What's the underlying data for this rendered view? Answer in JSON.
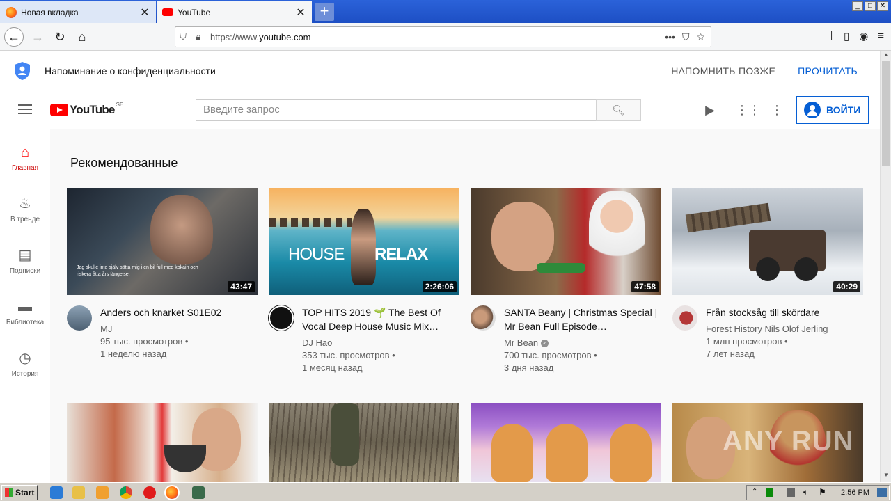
{
  "browser": {
    "tabs": [
      {
        "label": "Новая вкладка",
        "active": false
      },
      {
        "label": "YouTube",
        "active": true
      }
    ],
    "url_prefix": "https://www.",
    "url_host": "youtube.com"
  },
  "privacy": {
    "text": "Напоминание о конфиденциальности",
    "later": "НАПОМНИТЬ ПОЗЖЕ",
    "read": "ПРОЧИТАТЬ"
  },
  "header": {
    "logo": "YouTube",
    "country": "SE",
    "search_placeholder": "Введите запрос",
    "signin": "ВОЙТИ"
  },
  "sidebar": {
    "items": [
      {
        "label": "Главная",
        "icon": "home-icon",
        "glyph": "⌂"
      },
      {
        "label": "В тренде",
        "icon": "trending-icon",
        "glyph": "♨"
      },
      {
        "label": "Подписки",
        "icon": "subscriptions-icon",
        "glyph": "▤"
      },
      {
        "label": "Библиотека",
        "icon": "library-icon",
        "glyph": "▬"
      },
      {
        "label": "История",
        "icon": "history-icon",
        "glyph": "◷"
      }
    ]
  },
  "main": {
    "heading": "Рекомендованные",
    "videos": [
      {
        "title": "Anders och knarket S01E02",
        "channel": "MJ",
        "views": "95 тыс. просмотров •",
        "age": "1 неделю назад",
        "duration": "43:47",
        "subtitle": "Jag skulle inte själv sätta mig i en bil full med kokain och riskera åtta års fängelse."
      },
      {
        "title": "TOP HITS 2019 🌱 The Best Of Vocal Deep House Music Mix…",
        "channel": "DJ Hao",
        "views": "353 тыс. просмотров •",
        "age": "1 месяц назад",
        "duration": "2:26:06",
        "overlay": "HOUSE",
        "overlay2": "RELAX"
      },
      {
        "title": "SANTA Beany | Christmas Special | Mr Bean Full Episode…",
        "channel": "Mr Bean",
        "views": "700 тыс. просмотров •",
        "age": "3 дня назад",
        "duration": "47:58"
      },
      {
        "title": "Från stocksåg till skördare",
        "channel": "Forest History Nils Olof Jerling",
        "views": "1 млн просмотров •",
        "age": "7 лет назад",
        "duration": "40:29"
      }
    ]
  },
  "taskbar": {
    "start": "Start",
    "clock": "2:56 PM"
  },
  "watermark": "ANY RUN"
}
